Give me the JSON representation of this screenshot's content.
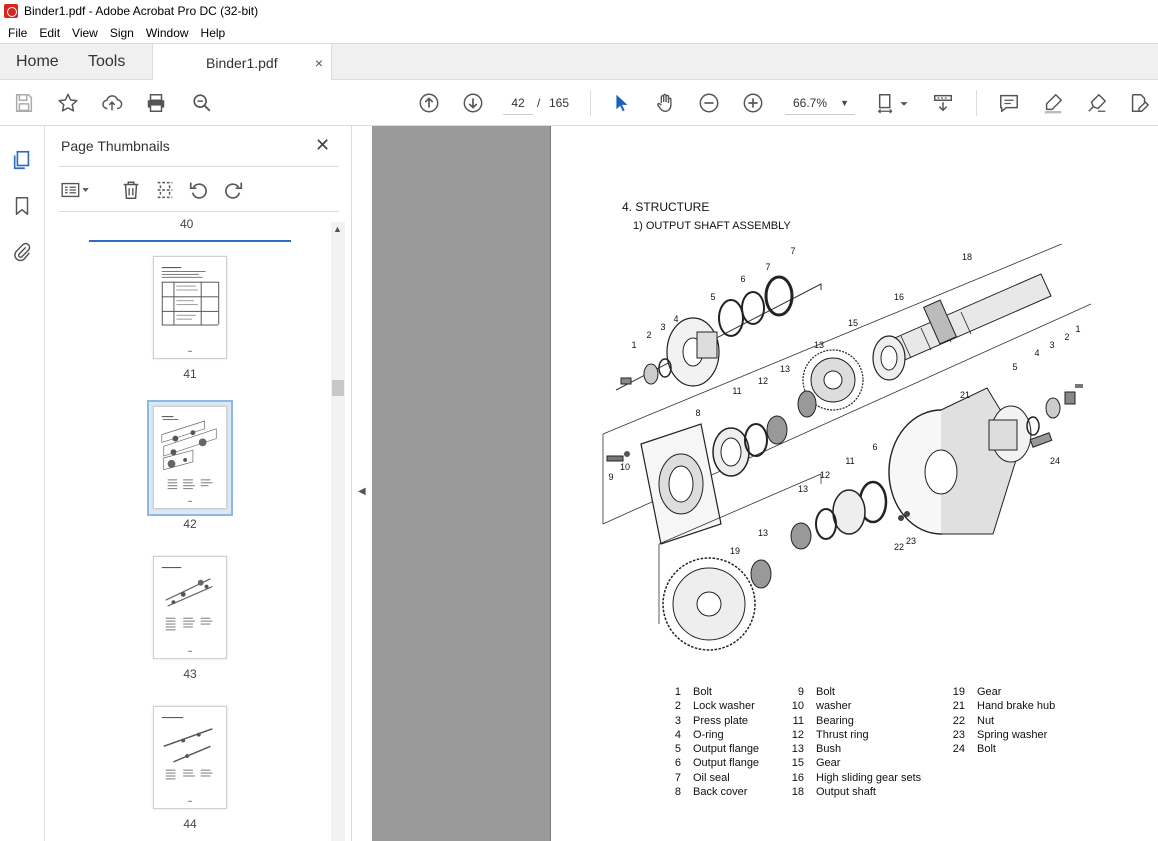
{
  "window": {
    "title": "Binder1.pdf - Adobe Acrobat Pro DC (32-bit)"
  },
  "menu": [
    "File",
    "Edit",
    "View",
    "Sign",
    "Window",
    "Help"
  ],
  "tabs": {
    "home": "Home",
    "tools": "Tools",
    "document": "Binder1.pdf",
    "close_glyph": "×"
  },
  "toolbar": {
    "current_page": "42",
    "separator": "/",
    "total_pages": "165",
    "zoom": "66.7%"
  },
  "thumbnails": {
    "title": "Page Thumbnails",
    "close_glyph": "✕",
    "pages": [
      {
        "label": "40"
      },
      {
        "label": "41"
      },
      {
        "label": "42",
        "selected": true
      },
      {
        "label": "43"
      },
      {
        "label": "44"
      }
    ]
  },
  "document": {
    "heading": "4. STRUCTURE",
    "subheading": "1) OUTPUT SHAFT ASSEMBLY",
    "callouts": [
      "1",
      "2",
      "3",
      "4",
      "5",
      "6",
      "7",
      "8",
      "9",
      "10",
      "11",
      "12",
      "13",
      "15",
      "16",
      "18",
      "19",
      "21",
      "22",
      "23",
      "24"
    ],
    "parts_col1": [
      {
        "num": "1",
        "name": "Bolt"
      },
      {
        "num": "2",
        "name": "Lock washer"
      },
      {
        "num": "3",
        "name": "Press plate"
      },
      {
        "num": "4",
        "name": "O-ring"
      },
      {
        "num": "5",
        "name": "Output flange"
      },
      {
        "num": "6",
        "name": "Output flange"
      },
      {
        "num": "7",
        "name": "Oil seal"
      },
      {
        "num": "8",
        "name": "Back cover"
      }
    ],
    "parts_col2": [
      {
        "num": "9",
        "name": "Bolt"
      },
      {
        "num": "10",
        "name": "washer"
      },
      {
        "num": "11",
        "name": "Bearing"
      },
      {
        "num": "12",
        "name": "Thrust ring"
      },
      {
        "num": "13",
        "name": "Bush"
      },
      {
        "num": "15",
        "name": "Gear"
      },
      {
        "num": "16",
        "name": "High sliding gear sets"
      },
      {
        "num": "18",
        "name": "Output shaft"
      }
    ],
    "parts_col3": [
      {
        "num": "19",
        "name": "Gear"
      },
      {
        "num": "21",
        "name": "Hand brake hub"
      },
      {
        "num": "22",
        "name": "Nut"
      },
      {
        "num": "23",
        "name": "Spring washer"
      },
      {
        "num": "24",
        "name": "Bolt"
      }
    ]
  },
  "colors": {
    "accent": "#2d6cbf",
    "select_pointer": "#1a5fc2",
    "panel_bg": "#f0f0f0",
    "doc_bg": "#9a9a9a"
  }
}
